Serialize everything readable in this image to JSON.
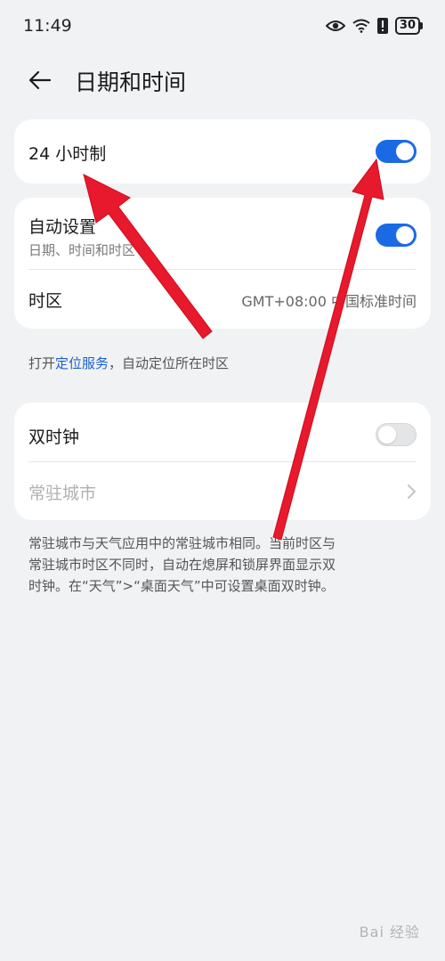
{
  "status": {
    "time": "11:49",
    "battery": "30"
  },
  "header": {
    "title": "日期和时间"
  },
  "hour24": {
    "label": "24 小时制",
    "enabled": true
  },
  "auto": {
    "label": "自动设置",
    "sub": "日期、时间和时区",
    "enabled": true
  },
  "timezone": {
    "label": "时区",
    "value": "GMT+08:00 中国标准时间"
  },
  "note1": {
    "prefix": "打开",
    "link": "定位服务",
    "suffix": "，自动定位所在时区"
  },
  "dual": {
    "label": "双时钟",
    "enabled": false
  },
  "resident": {
    "label": "常驻城市"
  },
  "note2": {
    "line1": "常驻城市与天气应用中的常驻城市相同。当前时区与",
    "line2": "常驻城市时区不同时，自动在熄屏和锁屏界面显示双",
    "line3": "时钟。在“天气”>“桌面天气”中可设置桌面双时钟。"
  },
  "watermark": "Bai 经验",
  "colors": {
    "accent": "#1a6ae6",
    "arrow": "#e8192c",
    "link": "#1a5fcf"
  },
  "icons": [
    "back-arrow-icon",
    "eye-icon",
    "wifi-icon",
    "alert-icon",
    "battery-icon",
    "chevron-right-icon"
  ]
}
